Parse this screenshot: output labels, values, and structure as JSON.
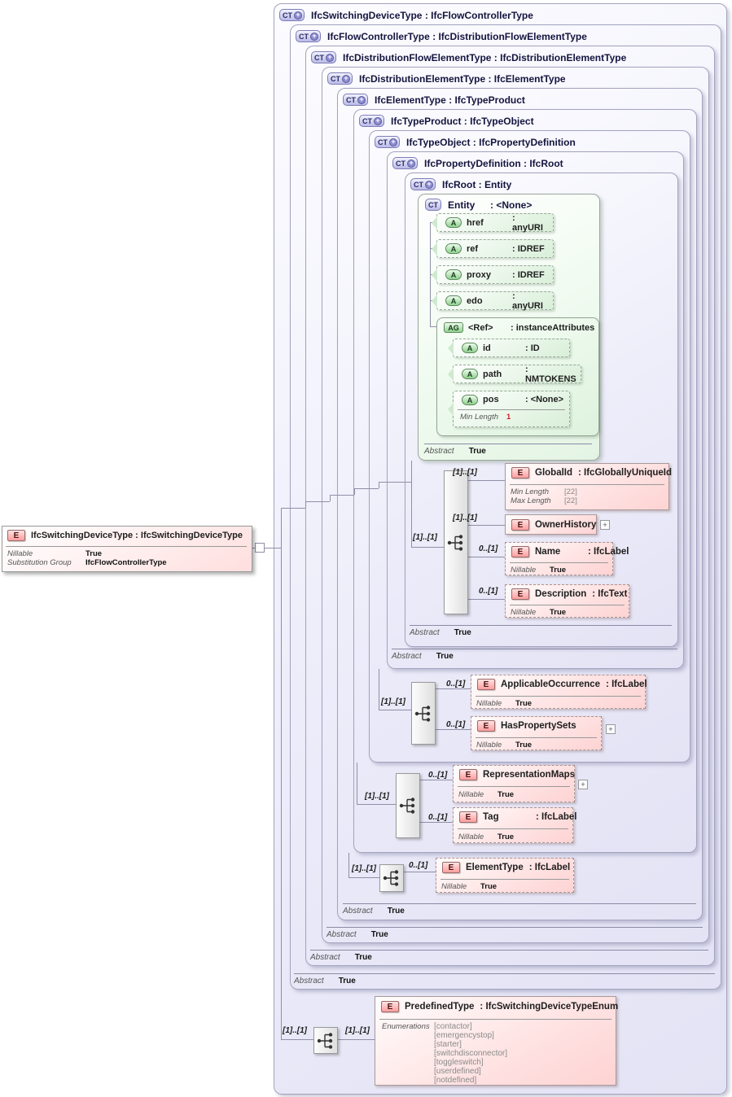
{
  "icons": {
    "ct": "CT",
    "e": "E",
    "a": "A",
    "ag": "AG",
    "plus": "+",
    "expand": "+"
  },
  "source_element": {
    "title": "IfcSwitchingDeviceType : IfcSwitchingDeviceType",
    "rows": [
      {
        "label": "Nillable",
        "value": "True"
      },
      {
        "label": "Substitution Group",
        "value": "IfcFlowControllerType"
      }
    ]
  },
  "levels": [
    {
      "title": "IfcSwitchingDeviceType : IfcFlowControllerType"
    },
    {
      "title": "IfcFlowControllerType : IfcDistributionFlowElementType",
      "abstract_label": "Abstract",
      "abstract_value": "True"
    },
    {
      "title": "IfcDistributionFlowElementType : IfcDistributionElementType",
      "abstract_label": "Abstract",
      "abstract_value": "True"
    },
    {
      "title": "IfcDistributionElementType : IfcElementType",
      "abstract_label": "Abstract",
      "abstract_value": "True"
    },
    {
      "title": "IfcElementType : IfcTypeProduct",
      "abstract_label": "Abstract",
      "abstract_value": "True"
    },
    {
      "title": "IfcTypeProduct : IfcTypeObject"
    },
    {
      "title": "IfcTypeObject : IfcPropertyDefinition"
    },
    {
      "title": "IfcPropertyDefinition : IfcRoot",
      "abstract_label": "Abstract",
      "abstract_value": "True"
    },
    {
      "title": "IfcRoot : Entity",
      "abstract_label": "Abstract",
      "abstract_value": "True"
    }
  ],
  "entity": {
    "title_name": "Entity",
    "title_type": ": <None>",
    "attributes": [
      {
        "name": "href",
        "type": ": anyURI"
      },
      {
        "name": "ref",
        "type": ": IDREF"
      },
      {
        "name": "proxy",
        "type": ": IDREF"
      },
      {
        "name": "edo",
        "type": ": anyURI"
      }
    ],
    "group": {
      "name": "<Ref>",
      "type": ": instanceAttributes",
      "attributes": [
        {
          "name": "id",
          "type": ": ID"
        },
        {
          "name": "path",
          "type": ": NMTOKENS"
        },
        {
          "name": "pos",
          "type": ": <None>",
          "constraint_label": "Min Length",
          "constraint_value": "1"
        }
      ]
    },
    "abstract_label": "Abstract",
    "abstract_value": "True"
  },
  "root_content": {
    "seq_cardinality": "[1]..[1]",
    "global_id": {
      "cardinality": "[1]..[1]",
      "name": "GlobalId",
      "type": ": IfcGloballyUniqueId",
      "props": [
        {
          "label": "Min Length",
          "value": "[22]"
        },
        {
          "label": "Max Length",
          "value": "[22]"
        }
      ]
    },
    "owner_history": {
      "cardinality": "[1]..[1]",
      "name": "OwnerHistory"
    },
    "name": {
      "cardinality": "0..[1]",
      "name": "Name",
      "type": ": IfcLabel",
      "nillable_label": "Nillable",
      "nillable_value": "True"
    },
    "description": {
      "cardinality": "0..[1]",
      "name": "Description",
      "type": ": IfcText",
      "nillable_label": "Nillable",
      "nillable_value": "True"
    }
  },
  "type_object_content": {
    "seq_cardinality": "[1]..[1]",
    "applicable_occurrence": {
      "cardinality": "0..[1]",
      "name": "ApplicableOccurrence",
      "type": ": IfcLabel",
      "nillable_label": "Nillable",
      "nillable_value": "True"
    },
    "has_property_sets": {
      "cardinality": "0..[1]",
      "name": "HasPropertySets",
      "nillable_label": "Nillable",
      "nillable_value": "True"
    }
  },
  "type_product_content": {
    "seq_cardinality": "[1]..[1]",
    "representation_maps": {
      "cardinality": "0..[1]",
      "name": "RepresentationMaps",
      "nillable_label": "Nillable",
      "nillable_value": "True"
    },
    "tag": {
      "cardinality": "0..[1]",
      "name": "Tag",
      "type": ": IfcLabel",
      "nillable_label": "Nillable",
      "nillable_value": "True"
    }
  },
  "element_type_content": {
    "seq_cardinality": "[1]..[1]",
    "element_type": {
      "cardinality": "0..[1]",
      "name": "ElementType",
      "type": ": IfcLabel",
      "nillable_label": "Nillable",
      "nillable_value": "True"
    }
  },
  "switching_device_content": {
    "seq_cardinality_left": "[1]..[1]",
    "seq_cardinality_right": "[1]..[1]",
    "predefined_type": {
      "name": "PredefinedType",
      "type": ": IfcSwitchingDeviceTypeEnum",
      "enum_label": "Enumerations",
      "enums": [
        "[contactor]",
        "[emergencystop]",
        "[starter]",
        "[switchdisconnector]",
        "[toggleswitch]",
        "[userdefined]",
        "[notdefined]"
      ]
    }
  }
}
